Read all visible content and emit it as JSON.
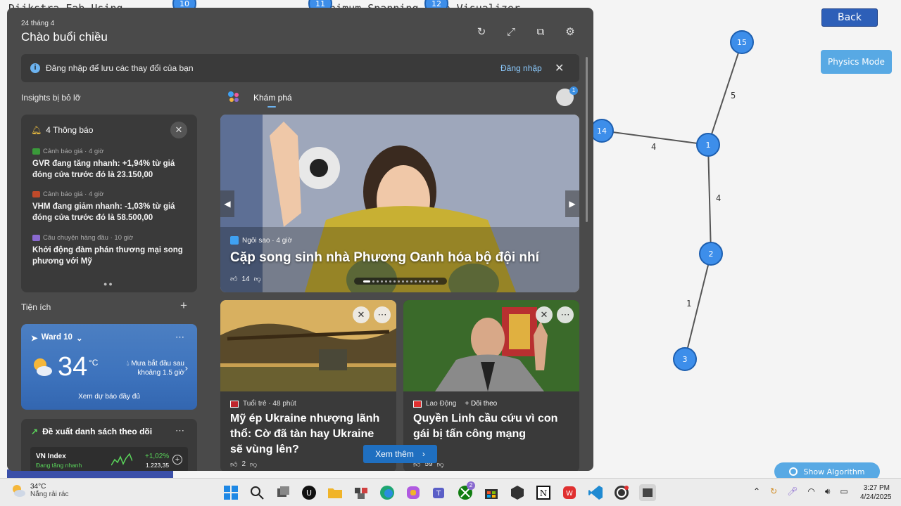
{
  "background_app": {
    "title_left": "Dijkstra Fab Using",
    "title_mid": "Minimum Spanning Tree Visualizer",
    "back_label": "Back",
    "physics_label": "Physics Mode",
    "algorithm_label": "Show Algorithm",
    "nodes": [
      "10",
      "11",
      "12",
      "14",
      "15",
      "1",
      "2",
      "3"
    ],
    "edge_weights": [
      "5",
      "4",
      "4",
      "1"
    ]
  },
  "panel": {
    "date": "24 tháng 4",
    "greeting": "Chào buổi chiều",
    "header_icons": [
      "refresh-icon",
      "expand-icon",
      "pin-icon",
      "settings-icon"
    ],
    "signin": {
      "message": "Đăng nhập để lưu các thay đổi của bạn",
      "link": "Đăng nhập"
    },
    "insights_label": "Insights bị bỏ lỡ",
    "notifications": {
      "title": "4 Thông báo",
      "items": [
        {
          "source": "Cảnh báo giá · 4 giờ",
          "text": "GVR đang tăng nhanh: +1,94% từ giá đóng cửa trước đó là 23.150,00"
        },
        {
          "source": "Cảnh báo giá · 4 giờ",
          "text": "VHM đang giảm nhanh: -1,03% từ giá đóng cửa trước đó là 58.500,00"
        },
        {
          "source": "Câu chuyện hàng đầu · 10 giờ",
          "text": "Khởi động đàm phán thương mại song phương với Mỹ"
        }
      ]
    },
    "utilities_label": "Tiện ích",
    "weather": {
      "location": "Ward 10",
      "temp": "34",
      "unit": "°C",
      "forecast": "Mưa bắt đầu sau khoảng 1.5 giờ",
      "button": "Xem dự báo đầy đủ"
    },
    "watchlist": {
      "title": "Đề xuất danh sách theo dõi",
      "name": "VN Index",
      "status": "Đang tăng nhanh",
      "change": "+1,02%",
      "value": "1.223,35"
    },
    "tab_explore": "Khám phá",
    "avatar_badge": "1",
    "hero": {
      "source": "Ngôi sao · 4 giờ",
      "title": "Cặp song sinh nhà Phương Oanh hóa bộ đội nhí",
      "likes": "14"
    },
    "cards": [
      {
        "source": "Tuổi trẻ · 48 phút",
        "title": "Mỹ ép Ukraine nhượng lãnh thổ: Cờ đã tàn hay Ukraine sẽ vùng lên?",
        "likes": "2"
      },
      {
        "source": "Lao Động",
        "follow": "+ Dõi theo",
        "title": "Quyền Linh cầu cứu vì con gái bị tấn công mạng",
        "likes": "59"
      }
    ],
    "see_more": "Xem thêm"
  },
  "taskbar": {
    "weather_temp": "34°C",
    "weather_desc": "Nắng rải rác",
    "time": "3:27 PM",
    "date": "4/24/2025",
    "teams_badge": "2"
  },
  "colors": {
    "panel_bg": "#4a4a4a",
    "card_bg": "#3a3a3a",
    "accent": "#1f6fc0",
    "node_blue": "#3d8eea",
    "up_green": "#5ad65a"
  }
}
